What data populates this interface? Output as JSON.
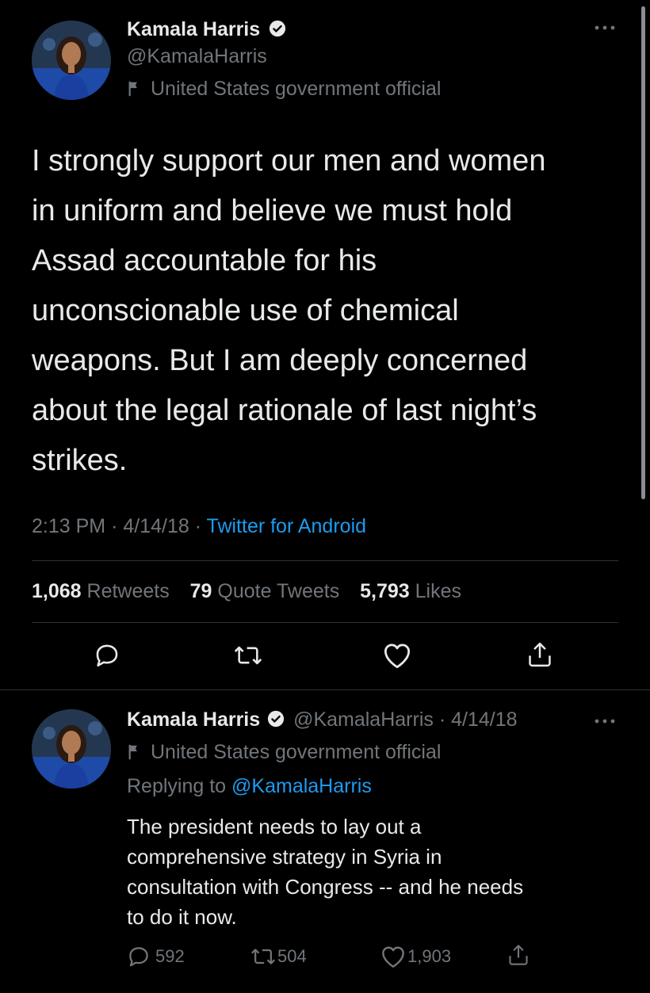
{
  "tweet": {
    "author_name": "Kamala Harris",
    "handle": "@KamalaHarris",
    "label": "United States government official",
    "text_lines": [
      "I strongly support our men and women",
      "in uniform and believe we must hold",
      "Assad accountable for his",
      "unconscionable use of chemical",
      "weapons. But I am deeply concerned",
      "about the legal rationale of last night’s",
      "strikes."
    ],
    "time": "2:13 PM",
    "date": "4/14/18",
    "source": "Twitter for Android",
    "retweets_count": "1,068",
    "retweets_label": "Retweets",
    "quotes_count": "79",
    "quotes_label": "Quote Tweets",
    "likes_count": "5,793",
    "likes_label": "Likes"
  },
  "reply": {
    "author_name": "Kamala Harris",
    "handle_date": "@KamalaHarris · 4/14/18",
    "label": "United States government official",
    "replying_prefix": "Replying to",
    "replying_handle": "@KamalaHarris",
    "text_lines": [
      "The president needs to lay out a",
      "comprehensive strategy in Syria in",
      "consultation with Congress -- and he needs",
      "to do it now."
    ],
    "replies_count": "592",
    "retweets_count": "504",
    "likes_count": "1,903"
  },
  "icons": {
    "more": "more-icon",
    "verified": "verified-badge-icon",
    "flag": "flag-icon",
    "reply": "reply-icon",
    "retweet": "retweet-icon",
    "like": "heart-icon",
    "share": "share-icon"
  },
  "colors": {
    "background": "#000000",
    "text": "#e7e9ea",
    "muted": "#71767b",
    "link": "#1d9bf0",
    "divider": "#2f3336"
  }
}
